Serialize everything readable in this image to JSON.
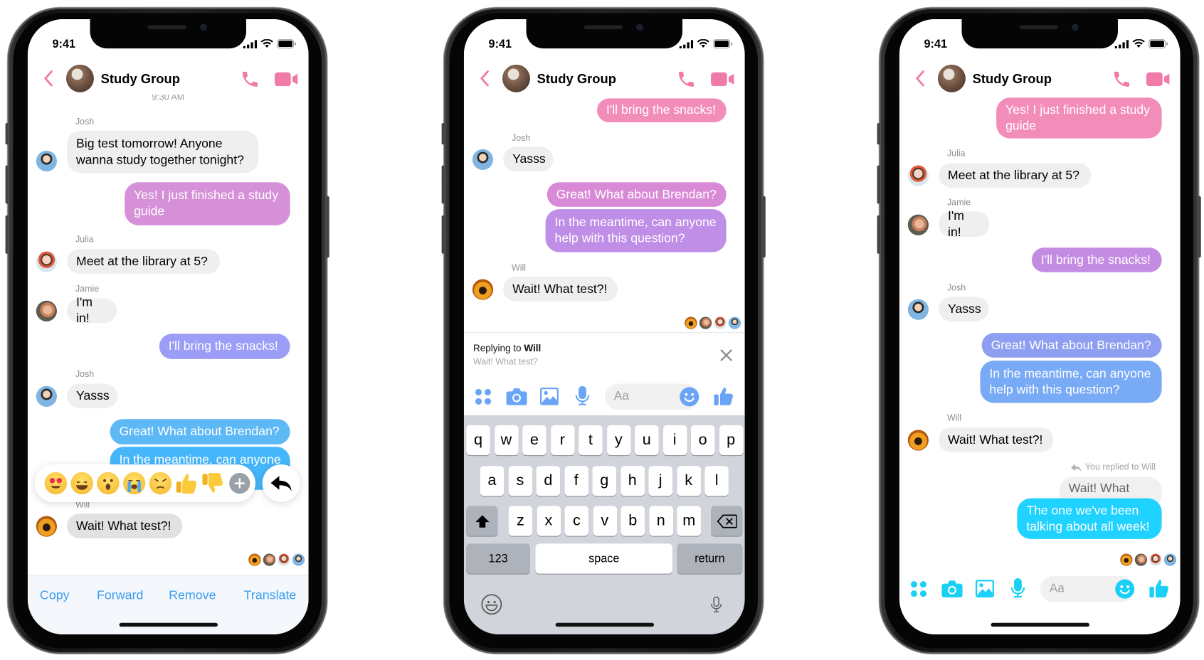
{
  "colors": {
    "header_accent": "#f07aa8",
    "action_blue": "#3b9cf0",
    "composer_blue": "#6aa5f5",
    "composer_cyan": "#1ad0f5"
  },
  "phones": [
    {
      "status_time": "9:41",
      "header": {
        "title": "Study Group"
      },
      "timestamp": "9:30 AM",
      "messages": [
        {
          "kind": "sender",
          "text": "Josh"
        },
        {
          "kind": "in",
          "text": "Big test tomorrow! Anyone wanna study together tonight?",
          "avatar": "josh"
        },
        {
          "kind": "out",
          "text": "Yes! I just finished a study guide",
          "color": "#d590d8"
        },
        {
          "kind": "sender",
          "text": "Julia"
        },
        {
          "kind": "in",
          "text": "Meet at the library at 5?",
          "avatar": "julia"
        },
        {
          "kind": "sender",
          "text": "Jamie"
        },
        {
          "kind": "in",
          "text": "I'm in!",
          "avatar": "jamie"
        },
        {
          "kind": "out",
          "text": "I'll bring the snacks!",
          "color": "#9b9df7"
        },
        {
          "kind": "sender",
          "text": "Josh"
        },
        {
          "kind": "in",
          "text": "Yasss",
          "avatar": "josh"
        },
        {
          "kind": "out",
          "text": "Great! What about Brendan?",
          "color": "#5db8f6"
        },
        {
          "kind": "out",
          "text": "In the meantime, can anyone help with this question?",
          "color": "#45b6fa"
        },
        {
          "kind": "sender",
          "text": "Will"
        },
        {
          "kind": "in",
          "text": "Wait! What test?!",
          "avatar": "will",
          "selected": true
        }
      ],
      "seen_by": [
        "will",
        "jamie",
        "julia",
        "josh"
      ],
      "reactions": [
        "heart-eyes",
        "laughing",
        "wow",
        "crying",
        "angry",
        "thumbs-up",
        "thumbs-down",
        "more"
      ],
      "actions": [
        "Copy",
        "Forward",
        "Remove",
        "Translate"
      ]
    },
    {
      "status_time": "9:41",
      "header": {
        "title": "Study Group"
      },
      "messages": [
        {
          "kind": "out",
          "text": "I'll bring the snacks!",
          "color": "#f28cb9"
        },
        {
          "kind": "sender",
          "text": "Josh"
        },
        {
          "kind": "in",
          "text": "Yasss",
          "avatar": "josh"
        },
        {
          "kind": "out",
          "text": "Great! What about Brendan?",
          "color": "#d98ad6"
        },
        {
          "kind": "out",
          "text": "In the meantime, can anyone help with this question?",
          "color": "#bf8ee6"
        },
        {
          "kind": "sender",
          "text": "Will"
        },
        {
          "kind": "in",
          "text": "Wait! What test?!",
          "avatar": "will"
        }
      ],
      "seen_by": [
        "will",
        "jamie",
        "julia",
        "josh"
      ],
      "reply_panel": {
        "prefix": "Replying to",
        "name": "Will",
        "quoted": "Wait! What test?"
      },
      "composer": {
        "placeholder": "Aa"
      },
      "keyboard": {
        "rows": [
          [
            "q",
            "w",
            "e",
            "r",
            "t",
            "y",
            "u",
            "i",
            "o",
            "p"
          ],
          [
            "a",
            "s",
            "d",
            "f",
            "g",
            "h",
            "j",
            "k",
            "l"
          ],
          [
            "z",
            "x",
            "c",
            "v",
            "b",
            "n",
            "m"
          ]
        ],
        "numbers_label": "123",
        "space_label": "space",
        "return_label": "return"
      }
    },
    {
      "status_time": "9:41",
      "header": {
        "title": "Study Group"
      },
      "messages": [
        {
          "kind": "out",
          "text": "Yes! I just finished a study guide",
          "color": "#f28cb9"
        },
        {
          "kind": "sender",
          "text": "Julia"
        },
        {
          "kind": "in",
          "text": "Meet at the library at 5?",
          "avatar": "julia"
        },
        {
          "kind": "sender",
          "text": "Jamie"
        },
        {
          "kind": "in",
          "text": "I'm in!",
          "avatar": "jamie"
        },
        {
          "kind": "out",
          "text": "I'll bring the snacks!",
          "color": "#c48be2"
        },
        {
          "kind": "sender",
          "text": "Josh"
        },
        {
          "kind": "in",
          "text": "Yasss",
          "avatar": "josh"
        },
        {
          "kind": "out",
          "text": "Great! What about Brendan?",
          "color": "#8e9ef0"
        },
        {
          "kind": "out",
          "text": "In the meantime, can anyone help with this question?",
          "color": "#78aaf6"
        },
        {
          "kind": "sender",
          "text": "Will"
        },
        {
          "kind": "in",
          "text": "Wait! What test?!",
          "avatar": "will"
        },
        {
          "kind": "note",
          "text": "You replied to Will"
        },
        {
          "kind": "quote",
          "text": "Wait! What test?!"
        },
        {
          "kind": "out",
          "text": "The one we've been talking about all week!",
          "color": "#20d2ff"
        }
      ],
      "seen_by": [
        "will",
        "jamie",
        "julia",
        "josh"
      ],
      "composer": {
        "placeholder": "Aa"
      }
    }
  ]
}
